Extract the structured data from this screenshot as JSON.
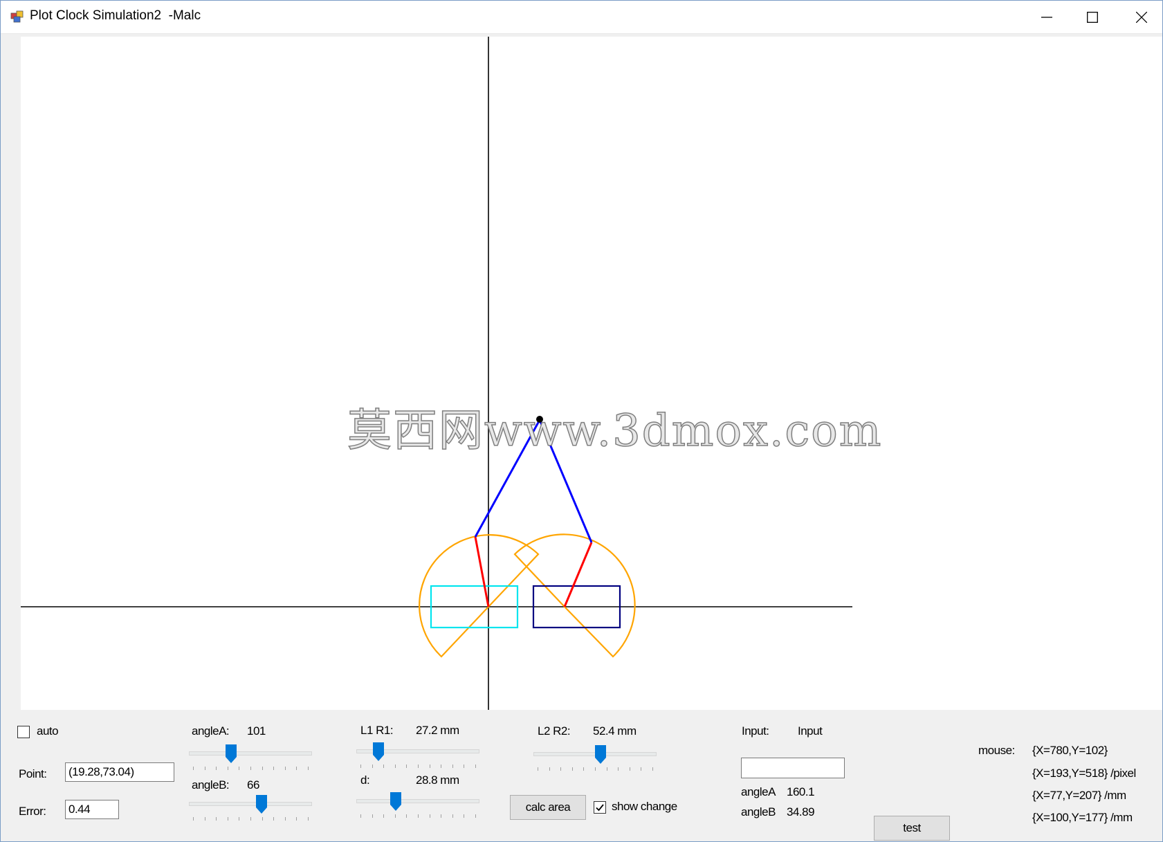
{
  "window": {
    "title": "Plot Clock Simulation2  -Malc",
    "controls": {
      "minimize": "minimize",
      "maximize": "maximize",
      "close": "close"
    }
  },
  "canvas": {
    "watermark": "莫西网www.3dmox.com",
    "colors": {
      "axis": "#000000",
      "upper_arm": "#0000ff",
      "lower_arm": "#ff0000",
      "reach_area": "#ffa500",
      "rect_left": "#00e5ee",
      "rect_right": "#000080",
      "pen_point": "#000000"
    }
  },
  "controls": {
    "auto": {
      "label": "auto",
      "checked": false
    },
    "point": {
      "label": "Point:",
      "value": "(19.28,73.04)"
    },
    "error": {
      "label": "Error:",
      "value": "0.44"
    },
    "angleA_slider": {
      "label": "angleA:",
      "value": "101",
      "fraction": 0.33
    },
    "angleB_slider": {
      "label": "angleB:",
      "value": "66",
      "fraction": 0.6
    },
    "l1r1": {
      "label": "L1 R1:",
      "value": "27.2 mm",
      "fraction": 0.15
    },
    "d": {
      "label": "d:",
      "value": "28.8 mm",
      "fraction": 0.3
    },
    "l2r2": {
      "label": "L2 R2:",
      "value": "52.4 mm",
      "fraction": 0.55
    },
    "calc_area": {
      "label": "calc area"
    },
    "show_change": {
      "label": "show change",
      "checked": true
    },
    "input": {
      "label": "Input:",
      "title": "Input",
      "value": ""
    },
    "angleA_out": {
      "label": "angleA",
      "value": "160.1"
    },
    "angleB_out": {
      "label": "angleB",
      "value": "34.89"
    },
    "test": {
      "label": "test"
    },
    "mouse": {
      "label": "mouse:",
      "lines": [
        "{X=780,Y=102}",
        "{X=193,Y=518} /pixel",
        "{X=77,Y=207} /mm",
        "{X=100,Y=177} /mm"
      ]
    }
  }
}
